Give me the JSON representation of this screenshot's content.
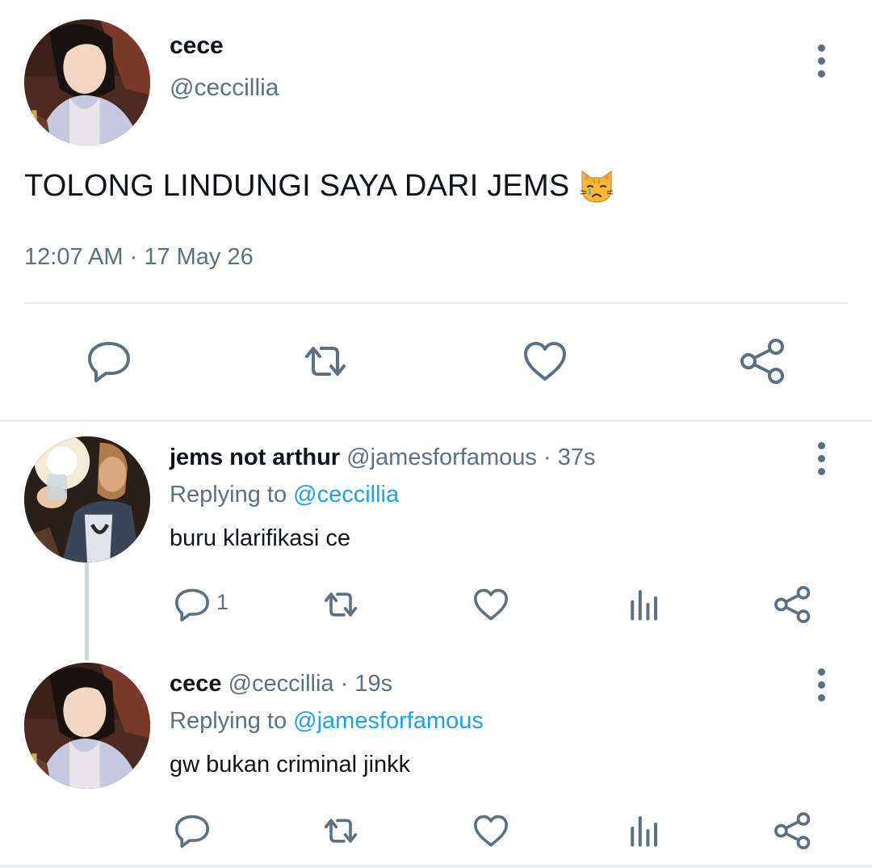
{
  "main_tweet": {
    "name": "cece",
    "handle": "@ceccillia",
    "text": "TOLONG LINDUNGI SAYA DARI JEMS",
    "emoji": "crying-cat-face",
    "time": "12:07 AM",
    "separator": "·",
    "date": "17 May 26",
    "actions": [
      "reply-icon",
      "retweet-icon",
      "like-icon",
      "share-icon"
    ]
  },
  "replies": [
    {
      "name": "jems not arthur",
      "handle": "@jamesforfamous",
      "separator": "·",
      "time": "37s",
      "replying_label": "Replying to",
      "replying_to": "@ceccillia",
      "text": "buru klarifikasi ce",
      "reply_count": "1"
    },
    {
      "name": "cece",
      "handle": "@ceccillia",
      "separator": "·",
      "time": "19s",
      "replying_label": "Replying to",
      "replying_to": "@jamesforfamous",
      "text": "gw bukan criminal jinkk",
      "reply_count": ""
    }
  ],
  "colors": {
    "text": "#0f1419",
    "secondary": "#5b7083",
    "link": "#1da1f2",
    "divider": "#e6ecf0",
    "thread_line": "#ccd6dd"
  }
}
